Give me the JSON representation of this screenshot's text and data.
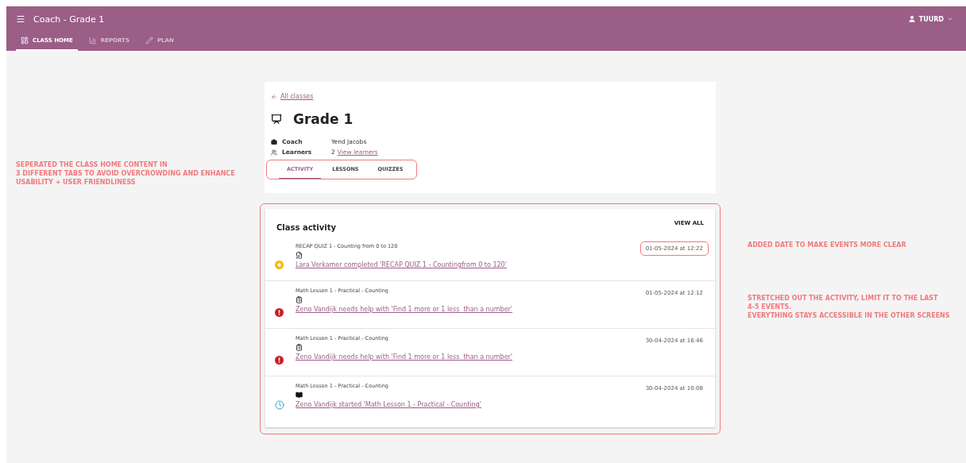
{
  "app_bar": {
    "title": "Coach - Grade 1",
    "user": "TUURD",
    "nav_tabs": [
      {
        "label": "CLASS HOME",
        "selected": true
      },
      {
        "label": "REPORTS",
        "selected": false
      },
      {
        "label": "PLAN",
        "selected": false
      }
    ]
  },
  "notes_left": [
    {
      "text": "SEPERATED THE CLASS HOME CONTENT IN\n3 DIFFERENT TABS TO AVOID OVERCROWDING AND ENHANCE\nUSABILITY + USER FRIENDLINESS"
    }
  ],
  "class_header": {
    "back_link": "All classes",
    "title": "Grade 1",
    "details": [
      {
        "kind": "coach",
        "label": "Coach",
        "value": "Yend Jacobs"
      },
      {
        "kind": "learners",
        "label": "Learners",
        "value": "2",
        "link": "View learners"
      }
    ],
    "tabs": [
      {
        "label": "ACTIVITY",
        "selected": true
      },
      {
        "label": "LESSONS",
        "selected": false
      },
      {
        "label": "QUIZZES",
        "selected": false
      }
    ]
  },
  "class_activity": {
    "title": "Class activity",
    "view_all": "VIEW ALL",
    "items": [
      {
        "kind": "completed",
        "context": "RECAP QUIZ 1 - Counting from 0 to 120",
        "message": "Lara Verkamer completed 'RECAP QUIZ 1 - Countingfrom 0 to 120'",
        "date": "01-05-2024 at 12:22",
        "highlighted": true
      },
      {
        "kind": "help",
        "context": "Math Lesson 1 - Practical - Counting",
        "message": "Zeno Vandijk needs help with 'Find 1 more or 1 less  than a number'",
        "date": "01-05-2024 at 12:12",
        "highlighted": false
      },
      {
        "kind": "help",
        "context": "Math Lesson 1 - Practical - Counting",
        "message": "Zeno Vandijk needs help with 'Find 1 more or 1 less  than a number'",
        "date": "30-04-2024 at 16:46",
        "highlighted": false
      },
      {
        "kind": "started",
        "context": "Math Lesson 1 - Practical - Counting",
        "message": "Zeno Vandijk started 'Math Lesson 1 - Practical - Counting'",
        "date": "30-04-2024 at 10:08",
        "highlighted": false
      }
    ]
  },
  "notes_right": [
    {
      "text": "ADDED DATE TO MAKE EVENTS MORE CLEAR"
    },
    {
      "text": "STRETCHED OUT THE ACTIVITY, LIMIT IT TO THE LAST\n4-5 EVENTS.\nEVERYTHING STAYS ACCESSIBLE IN THE OTHER SCREENS"
    }
  ]
}
